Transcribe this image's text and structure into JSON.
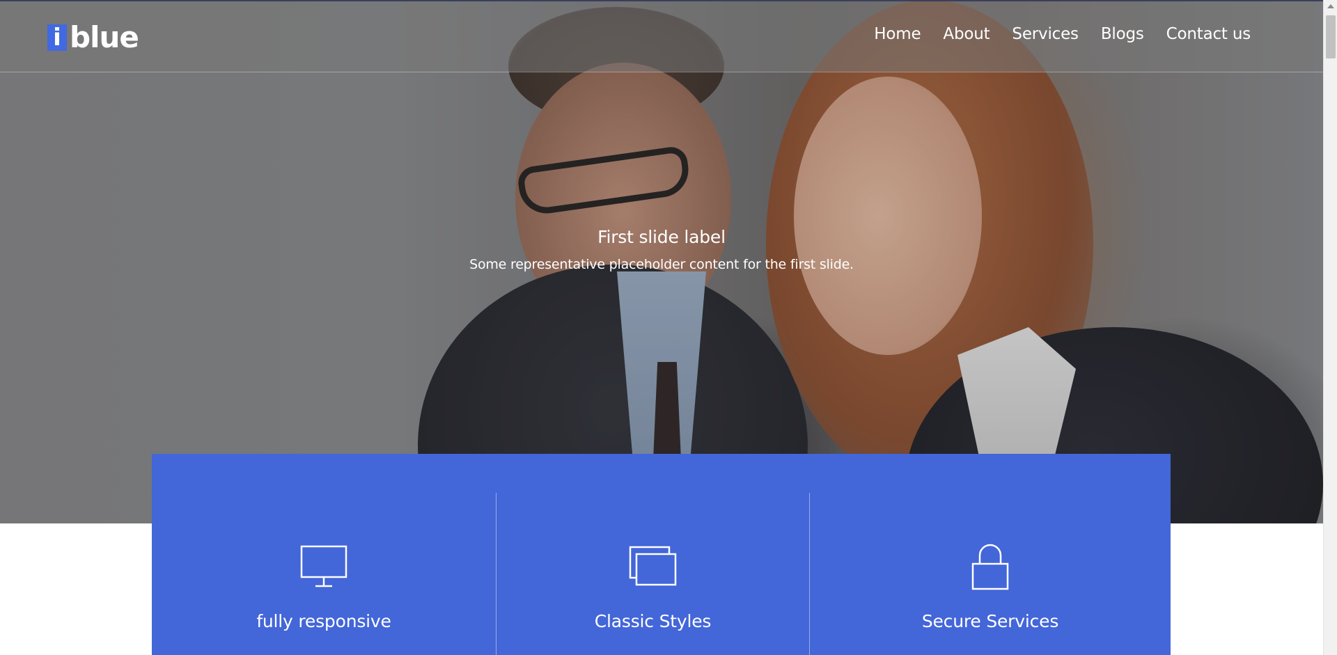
{
  "brand": {
    "logo_mark": "i",
    "logo_text": "blue",
    "accent": "#4169e1"
  },
  "nav": {
    "items": [
      {
        "label": "Home"
      },
      {
        "label": "About"
      },
      {
        "label": "Services"
      },
      {
        "label": "Blogs"
      },
      {
        "label": "Contact us"
      }
    ]
  },
  "carousel": {
    "slide_title": "First slide label",
    "slide_text": "Some representative placeholder content for the first slide."
  },
  "features": {
    "panel_color": "#4366d9",
    "items": [
      {
        "label": "fully responsive",
        "icon": "monitor-icon"
      },
      {
        "label": "Classic Styles",
        "icon": "windows-icon"
      },
      {
        "label": "Secure Services",
        "icon": "lock-icon"
      }
    ]
  }
}
